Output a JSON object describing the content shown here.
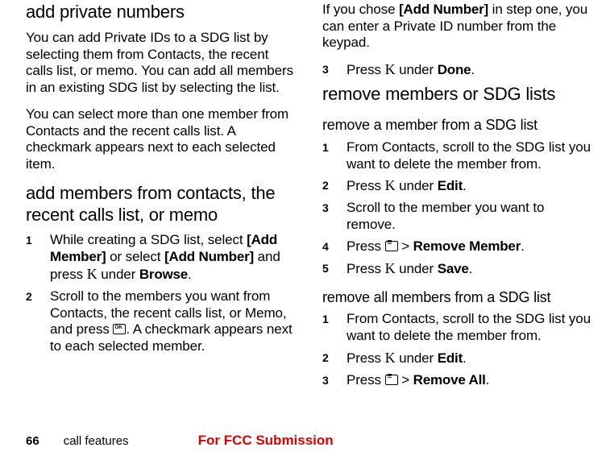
{
  "col1": {
    "h_add_private": "add private numbers",
    "p_private_1": "You can add Private IDs to a SDG list by selecting them from Contacts, the recent calls list, or memo. You can add all members in an existing SDG list by selecting the list.",
    "p_private_2": "You can select more than one member from Contacts and the recent calls list. A checkmark appears next to each selected item.",
    "h_add_members": "add members from contacts, the recent calls list, or memo",
    "step1": {
      "num": "1",
      "pre": "While creating a SDG list, select ",
      "b1": "[Add Member]",
      "mid": " or select ",
      "b2": "[Add Number]",
      "post1": " and press ",
      "key": "K",
      "post2": " under ",
      "b3": "Browse",
      "dot": "."
    },
    "step2": {
      "num": "2",
      "pre": "Scroll to the members you want from Contacts, the recent calls list, or Memo, and press ",
      "post": ". A checkmark appears next to each selected member."
    }
  },
  "col2": {
    "p_intro_pre": "If you chose ",
    "p_intro_b": "[Add Number]",
    "p_intro_post": " in step one, you can enter a Private ID number from the keypad.",
    "step3": {
      "num": "3",
      "pre": "Press ",
      "key": "K",
      "mid": " under ",
      "b": "Done",
      "dot": "."
    },
    "h_remove": "remove members or SDG lists",
    "h_remove_member": "remove a member from a SDG list",
    "rm1": {
      "num": "1",
      "text": "From Contacts, scroll to the SDG list you want to delete the member from."
    },
    "rm2": {
      "num": "2",
      "pre": "Press ",
      "key": "K",
      "mid": " under ",
      "b": "Edit",
      "dot": "."
    },
    "rm3": {
      "num": "3",
      "text": "Scroll to the member you want to remove."
    },
    "rm4": {
      "num": "4",
      "pre": "Press ",
      "gt": " > ",
      "b": "Remove Member",
      "dot": "."
    },
    "rm5": {
      "num": "5",
      "pre": "Press ",
      "key": "K",
      "mid": " under ",
      "b": "Save",
      "dot": "."
    },
    "h_remove_all": "remove all members from a SDG list",
    "ra1": {
      "num": "1",
      "text": "From Contacts, scroll to the SDG list you want to delete the member from."
    },
    "ra2": {
      "num": "2",
      "pre": "Press ",
      "key": "K",
      "mid": " under ",
      "b": "Edit",
      "dot": "."
    },
    "ra3": {
      "num": "3",
      "pre": "Press ",
      "gt": " > ",
      "b": "Remove All",
      "dot": "."
    }
  },
  "footer": {
    "page": "66",
    "section": "call features",
    "fcc": "For FCC Submission"
  }
}
